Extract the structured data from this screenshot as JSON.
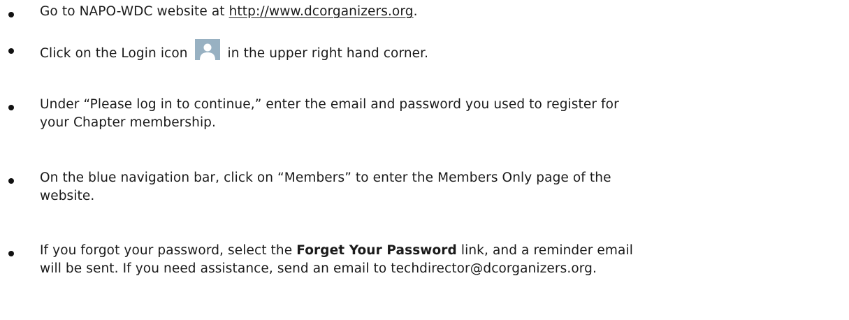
{
  "instructions": {
    "step1": {
      "prefix": "Go to NAPO-WDC website at ",
      "link": "http://www.dcorganizers.org",
      "suffix": "."
    },
    "step2": {
      "prefix": "Click on the Login icon",
      "icon": "user-silhouette-icon",
      "suffix": "in the upper right hand corner."
    },
    "step3": {
      "line1": "Under “Please log in to continue,” enter the email and password you used to register for",
      "line2": "your Chapter membership."
    },
    "step4": {
      "line1": "On the blue navigation bar, click on “Members” to enter the Members Only page of the",
      "line2": "website."
    },
    "step5": {
      "prefix": "If you forgot your password, select the ",
      "bold": "Forget Your Password",
      "middle": " link, and a reminder email",
      "line2": "will be sent.  If you need assistance, send an email to techdirector@dcorganizers.org."
    }
  },
  "colors": {
    "text": "#1a1a1a",
    "icon_background": "#98b1c2",
    "icon_silhouette": "#ffffff"
  }
}
